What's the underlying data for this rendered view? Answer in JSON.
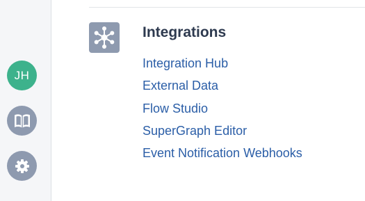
{
  "sidebar": {
    "avatar_initials": "JH",
    "avatar_color": "#3db28c",
    "icon_color": "#8e9aaf",
    "items": [
      {
        "icon": "book-icon"
      },
      {
        "icon": "gear-icon"
      }
    ]
  },
  "section": {
    "icon": "integrations-hub-icon",
    "title": "Integrations",
    "links": [
      {
        "label": "Integration Hub"
      },
      {
        "label": "External Data"
      },
      {
        "label": "Flow Studio"
      },
      {
        "label": "SuperGraph Editor"
      },
      {
        "label": "Event Notification Webhooks"
      }
    ]
  },
  "colors": {
    "title": "#2e3a4f",
    "link": "#2b5ea7",
    "sidebar_bg": "#f5f6f8"
  }
}
